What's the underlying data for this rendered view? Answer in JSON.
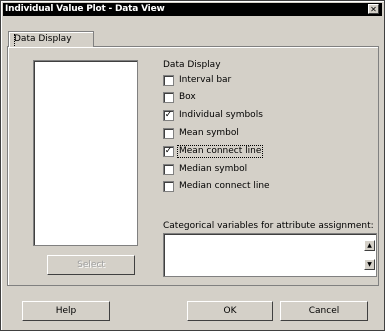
{
  "window": {
    "title": "Individual Value Plot - Data View",
    "close_glyph": "✕"
  },
  "tabs": [
    {
      "label": "Data Display"
    }
  ],
  "variables_list": {
    "select_label": "Select"
  },
  "data_display": {
    "group_label": "Data Display",
    "options": [
      {
        "label": "Interval bar",
        "checked": false
      },
      {
        "label": "Box",
        "checked": false
      },
      {
        "label": "Individual symbols",
        "checked": true
      },
      {
        "label": "Mean symbol",
        "checked": false
      },
      {
        "label": "Mean connect line",
        "checked": true
      },
      {
        "label": "Median symbol",
        "checked": false
      },
      {
        "label": "Median connect line",
        "checked": false
      }
    ]
  },
  "categorical": {
    "label": "Categorical variables for attribute assignment:",
    "value": ""
  },
  "buttons": {
    "help": "Help",
    "ok": "OK",
    "cancel": "Cancel"
  }
}
